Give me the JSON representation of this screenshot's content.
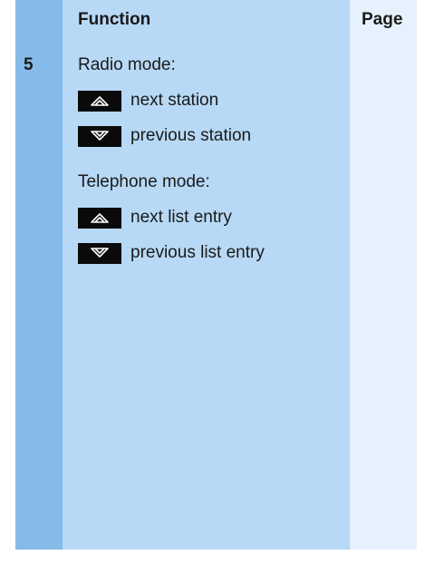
{
  "table": {
    "header": {
      "function": "Function",
      "page": "Page"
    },
    "row": {
      "number": "5",
      "groups": [
        {
          "label": "Radio mode:",
          "items": [
            {
              "icon": "arrow-up-icon",
              "text": "next station"
            },
            {
              "icon": "arrow-down-icon",
              "text": "previous station"
            }
          ]
        },
        {
          "label": "Telephone mode:",
          "items": [
            {
              "icon": "arrow-up-icon",
              "text": "next list entry"
            },
            {
              "icon": "arrow-down-icon",
              "text": "previous list entry"
            }
          ]
        }
      ]
    }
  }
}
